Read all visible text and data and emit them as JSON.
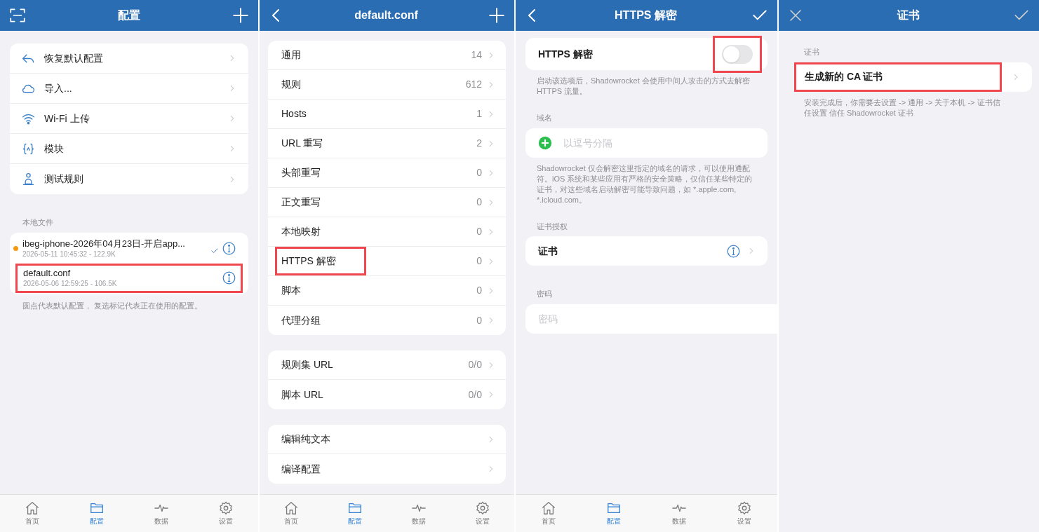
{
  "panels": [
    {
      "kind": "config",
      "header": {
        "title": "配置"
      },
      "menu": [
        {
          "label": "恢复默认配置"
        },
        {
          "label": "导入..."
        },
        {
          "label": "Wi-Fi 上传"
        },
        {
          "label": "模块"
        },
        {
          "label": "测试规则"
        }
      ],
      "section_label": "本地文件",
      "files": [
        {
          "name": "ibeg-iphone-2026年04月23日-开启app...",
          "meta": "2026-05-11 10:45:32 - 122.9K",
          "default": true,
          "in_use": true,
          "highlighted": false
        },
        {
          "name": "default.conf",
          "meta": "2026-05-06 12:59:25 - 106.5K",
          "default": false,
          "in_use": false,
          "highlighted": true
        }
      ],
      "footnote": "圆点代表默认配置， 复选标记代表正在使用的配置。",
      "tab_bar": [
        {
          "label": "首页",
          "selected": false
        },
        {
          "label": "配置",
          "selected": true
        },
        {
          "label": "数据",
          "selected": false
        },
        {
          "label": "设置",
          "selected": false
        }
      ]
    },
    {
      "kind": "conf_detail",
      "header": {
        "title": "default.conf"
      },
      "groups": [
        [
          {
            "label": "通用",
            "value": "14",
            "highlighted": false
          },
          {
            "label": "规则",
            "value": "612",
            "highlighted": false
          },
          {
            "label": "Hosts",
            "value": "1",
            "highlighted": false
          },
          {
            "label": "URL 重写",
            "value": "2",
            "highlighted": false
          },
          {
            "label": "头部重写",
            "value": "0",
            "highlighted": false
          },
          {
            "label": "正文重写",
            "value": "0",
            "highlighted": false
          },
          {
            "label": "本地映射",
            "value": "0",
            "highlighted": false
          },
          {
            "label": "HTTPS 解密",
            "value": "0",
            "highlighted": true
          },
          {
            "label": "脚本",
            "value": "0",
            "highlighted": false
          },
          {
            "label": "代理分组",
            "value": "0",
            "highlighted": false
          }
        ],
        [
          {
            "label": "规则集 URL",
            "value": "0/0",
            "highlighted": false
          },
          {
            "label": "脚本 URL",
            "value": "0/0",
            "highlighted": false
          }
        ],
        [
          {
            "label": "编辑纯文本",
            "highlighted": false
          },
          {
            "label": "编译配置",
            "highlighted": false
          }
        ]
      ],
      "tab_bar": [
        {
          "label": "首页",
          "selected": false
        },
        {
          "label": "配置",
          "selected": true
        },
        {
          "label": "数据",
          "selected": false
        },
        {
          "label": "设置",
          "selected": false
        }
      ]
    },
    {
      "kind": "https",
      "header": {
        "title": "HTTPS 解密"
      },
      "toggle": {
        "label": "HTTPS 解密",
        "on": false,
        "highlighted": true
      },
      "toggle_note": "启动该选项后，Shadowrocket 会使用中间人攻击的方式去解密 HTTPS 流量。",
      "domain": {
        "label": "域名",
        "placeholder": "以逗号分隔",
        "note": "Shadowrocket 仅会解密这里指定的域名的请求，可以使用通配符。iOS 系统和某些应用有严格的安全策略，仅信任某些特定的证书，对这些域名启动解密可能导致问题，如 *.apple.com, *.icloud.com。"
      },
      "certificate": {
        "label": "证书授权",
        "row": "证书"
      },
      "password": {
        "label": "密码",
        "placeholder": "密码"
      },
      "tab_bar": [
        {
          "label": "首页",
          "selected": false
        },
        {
          "label": "配置",
          "selected": true
        },
        {
          "label": "数据",
          "selected": false
        },
        {
          "label": "设置",
          "selected": false
        }
      ]
    },
    {
      "kind": "certificate",
      "header": {
        "title": "证书"
      },
      "section_label": "证书",
      "rows": [
        {
          "label": "生成新的 CA 证书",
          "highlighted": true
        }
      ],
      "note": "安装完成后，你需要去设置 -> 通用 -> 关于本机 -> 证书信任设置 信任 Shadowrocket 证书"
    }
  ]
}
